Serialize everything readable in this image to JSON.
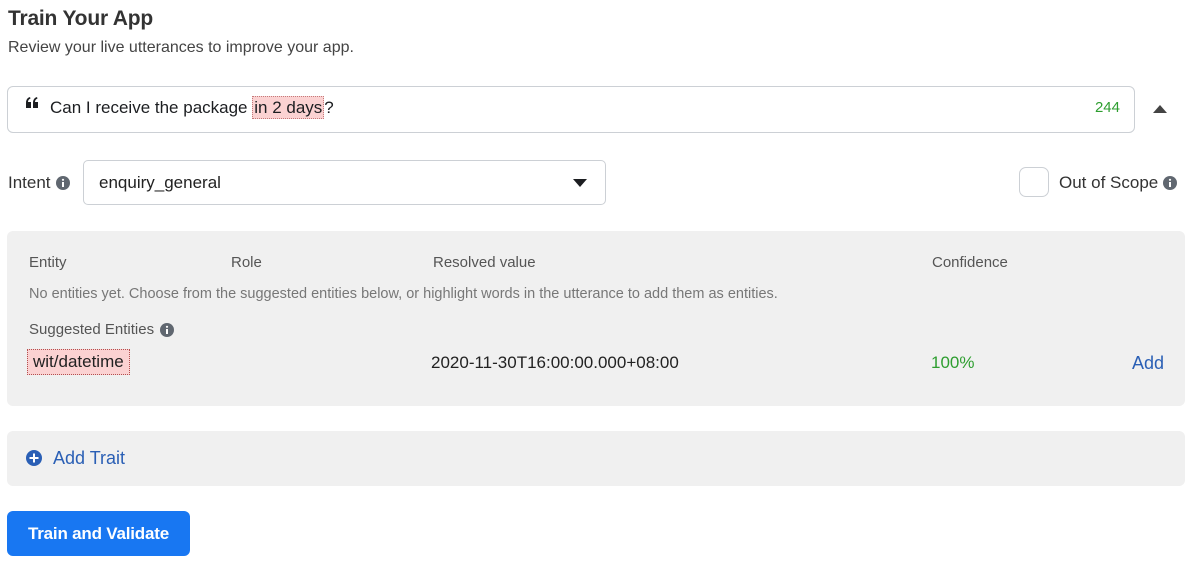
{
  "header": {
    "title": "Train Your App",
    "subtitle": "Review your live utterances to improve your app."
  },
  "utterance": {
    "before": "Can I receive the package ",
    "highlight": "in 2 days",
    "after": "?",
    "count": "244"
  },
  "intent": {
    "label": "Intent",
    "value": "enquiry_general"
  },
  "out_of_scope": {
    "label": "Out of Scope",
    "checked": false
  },
  "entities": {
    "columns": [
      "Entity",
      "Role",
      "Resolved value",
      "Confidence"
    ],
    "empty_note": "No entities yet. Choose from the suggested entities below, or highlight words in the utterance to add them as entities.",
    "suggested_label": "Suggested Entities",
    "suggested": [
      {
        "name": "wit/datetime",
        "resolved": "2020-11-30T16:00:00.000+08:00",
        "confidence": "100%",
        "action": "Add"
      }
    ]
  },
  "trait": {
    "label": "Add Trait"
  },
  "actions": {
    "train_label": "Train and Validate"
  },
  "colors": {
    "primary": "#1877f2",
    "link": "#2a5fb5",
    "success": "#2e9e30",
    "highlight": "#fbd2d2",
    "panel": "#f0f0f0"
  },
  "icons": {
    "quote": "quote-icon",
    "collapse": "caret-up-icon",
    "dropdown": "caret-down-icon",
    "info": "info-icon",
    "add_trait": "plus-circle-icon"
  }
}
